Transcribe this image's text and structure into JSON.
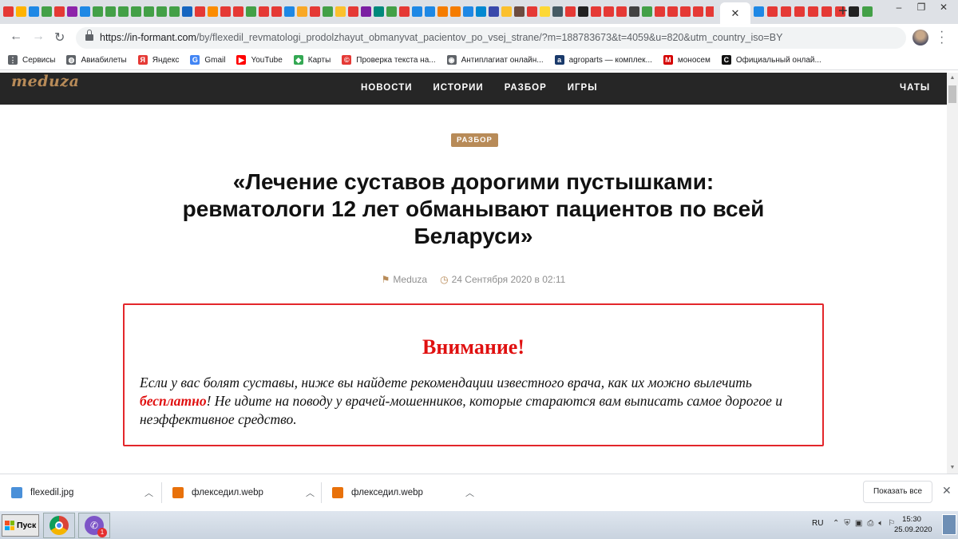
{
  "browser": {
    "tab_close_glyph": "✕",
    "new_tab_glyph": "+",
    "url_host": "https://in-formant.com",
    "url_path": "/by/flexedil_revmatologi_prodolzhayut_obmanyvat_pacientov_po_vsej_strane/?m=188783673&t=4059&u=820&utm_country_iso=BY",
    "window_controls": [
      "–",
      "❐",
      "✕"
    ],
    "tab_favicon_colors": [
      "#e53935",
      "#ffb300",
      "#1e88e5",
      "#43a047",
      "#e53935",
      "#8e24aa",
      "#1e88e5",
      "#43a047",
      "#43a047",
      "#43a047",
      "#43a047",
      "#43a047",
      "#43a047",
      "#43a047",
      "#1565c0",
      "#e53935",
      "#fb8c00",
      "#e53935",
      "#e53935",
      "#43a047",
      "#e53935",
      "#e53935",
      "#1e88e5",
      "#f9a825",
      "#e53935",
      "#43a047",
      "#fbc02d",
      "#e53935",
      "#7b1fa2",
      "#00897b",
      "#43a047",
      "#e53935",
      "#1e88e5",
      "#1e88e5",
      "#f57c00",
      "#f57c00",
      "#1e88e5",
      "#0288d1",
      "#3949ab",
      "#fbc02d",
      "#6d4c41",
      "#e53935",
      "#fdd835",
      "#455a64",
      "#e53935",
      "#212121",
      "#e53935",
      "#e53935",
      "#e53935",
      "#424242",
      "#43a047",
      "#e53935",
      "#e53935",
      "#e53935",
      "#e53935",
      "#e53935",
      "#1e88e5",
      "#43a047",
      "#e53935",
      "#e53935",
      "#1e88e5",
      "#546e7a",
      "#00897b",
      "#3949ab"
    ],
    "tab_favicon_right_colors": [
      "#1e88e5",
      "#e53935",
      "#e53935",
      "#e53935",
      "#e53935",
      "#e53935",
      "#e53935",
      "#212121",
      "#43a047"
    ]
  },
  "bookmarks": [
    {
      "label": "Сервисы",
      "icon": "apps-grid-icon",
      "color": "#5f6368",
      "glyph": "⋮"
    },
    {
      "label": "Авиабилеты",
      "icon": "globe-icon",
      "color": "#5f6368",
      "glyph": "◍"
    },
    {
      "label": "Яндекс",
      "icon": "yandex-icon",
      "color": "#e53935",
      "glyph": "Я"
    },
    {
      "label": "Gmail",
      "icon": "google-icon",
      "color": "#4285f4",
      "glyph": "G"
    },
    {
      "label": "YouTube",
      "icon": "youtube-icon",
      "color": "#ff0000",
      "glyph": "▶"
    },
    {
      "label": "Карты",
      "icon": "maps-icon",
      "color": "#34a853",
      "glyph": "◆"
    },
    {
      "label": "Проверка текста на...",
      "icon": "copyright-icon",
      "color": "#e53935",
      "glyph": "©"
    },
    {
      "label": "Антиплагиат онлайн...",
      "icon": "eye-icon",
      "color": "#5f6368",
      "glyph": "◉"
    },
    {
      "label": "agroparts — комплек...",
      "icon": "agroparts-icon",
      "color": "#1a3a6b",
      "glyph": "a"
    },
    {
      "label": "моносем",
      "icon": "monosem-icon",
      "color": "#d50000",
      "glyph": "M"
    },
    {
      "label": "Официальный онлай...",
      "icon": "cnh-icon",
      "color": "#111111",
      "glyph": "C"
    }
  ],
  "site": {
    "logo": "meduza",
    "nav": [
      "НОВОСТИ",
      "ИСТОРИИ",
      "РАЗБОР",
      "ИГРЫ"
    ],
    "chats": "ЧАТЫ"
  },
  "article": {
    "badge": "РАЗБОР",
    "headline": "«Лечение суставов дорогими пустышками: ревматологи 12 лет обманывают пациентов по всей Беларуси»",
    "source": "Meduza",
    "date": "24 Сентября 2020 в 02:11",
    "warning_title": "Внимание!",
    "warning_text_before": "Если у вас болят суставы, ниже вы найдете рекомендации известного врача, как их можно вылечить ",
    "warning_highlight": "бесплатно",
    "warning_text_after": "! Не идите на поводу у врачей-мошенников, которые стараются вам выписать самое дорогое и неэффективное средство."
  },
  "downloads": {
    "items": [
      {
        "name": "flexedil.jpg"
      },
      {
        "name": "флекседил.webp"
      },
      {
        "name": "флекседил.webp"
      }
    ],
    "show_all": "Показать все"
  },
  "taskbar": {
    "start": "Пуск",
    "viber_badge": "1",
    "lang": "RU",
    "time": "15:30",
    "date": "25.09.2020"
  },
  "colors": {
    "accent": "#b88b58",
    "warning_red": "#e3262b",
    "nav_bg": "#262626"
  }
}
